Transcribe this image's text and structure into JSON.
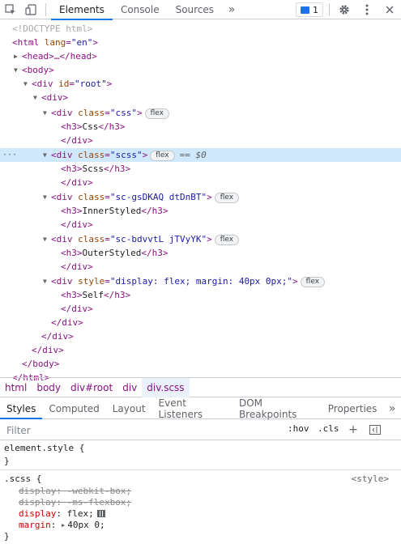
{
  "toolbar": {
    "tabs": [
      "Elements",
      "Console",
      "Sources"
    ],
    "issues_count": "1",
    "icons": [
      "inspect-icon",
      "device-toggle-icon",
      "more-tabs-icon",
      "issues-icon",
      "settings-gear-icon",
      "kebab-menu-icon",
      "close-icon"
    ]
  },
  "dom": {
    "doctype": "<!DOCTYPE html>",
    "html_open": "<html",
    "html_lang_attr": "lang",
    "html_lang_val": "\"en\"",
    "head": "<head>…</head>",
    "body_open": "<body>",
    "root_div_open": "<div",
    "root_id_attr": "id",
    "root_id_val": "\"root\"",
    "inner_div_open": "<div>",
    "rows": [
      {
        "cls": "\"css\"",
        "h3": "Css"
      },
      {
        "cls": "\"scss\"",
        "h3": "Scss"
      },
      {
        "cls": "\"sc-gsDKAQ dtDnBT\"",
        "h3": "InnerStyled"
      },
      {
        "cls": "\"sc-bdvvtL jTVyYK\"",
        "h3": "OuterStyled"
      }
    ],
    "style_row": {
      "attr": "style",
      "val": "\"display: flex; margin: 40px 0px;\"",
      "h3": "Self"
    },
    "class_attr": "class",
    "flex_badge": "flex",
    "selected_marker": "== $0",
    "div_close": "</div>",
    "body_close": "</body>",
    "html_close": "</html>",
    "h3_open": "<h3>",
    "h3_close": "</h3>"
  },
  "breadcrumbs": [
    "html",
    "body",
    "div#root",
    "div",
    "div.scss"
  ],
  "pane_tabs": [
    "Styles",
    "Computed",
    "Layout",
    "Event Listeners",
    "DOM Breakpoints",
    "Properties"
  ],
  "filter": {
    "placeholder": "Filter",
    "hov": ":hov",
    "cls": ".cls"
  },
  "rules": {
    "element_style": {
      "selector": "element.style {",
      "close": "}"
    },
    "scss": {
      "selector": ".scss {",
      "source": "<style>",
      "decls": [
        {
          "prop": "display",
          "val": "-webkit-box;",
          "overridden": true
        },
        {
          "prop": "display",
          "val": "-ms-flexbox;",
          "overridden": true
        },
        {
          "prop": "display",
          "val": "flex;",
          "overridden": false
        },
        {
          "prop": "margin",
          "val": "40px 0;",
          "overridden": false
        }
      ],
      "close": "}"
    }
  },
  "colors": {
    "accent": "#1a73e8",
    "selected_row": "#cfe8fc",
    "tag": "#881280",
    "attr_name": "#994500",
    "attr_value": "#1a1aa6",
    "css_prop": "#c80000"
  }
}
